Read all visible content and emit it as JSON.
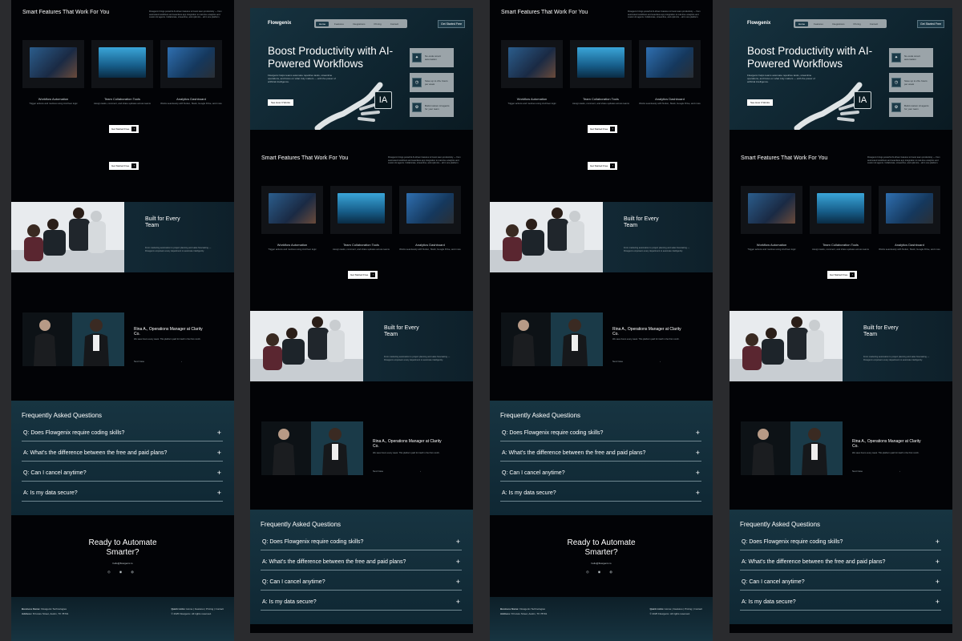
{
  "nav": {
    "brand": "Flowgenix",
    "links": [
      "Home",
      "Features",
      "Integrations",
      "Pricing",
      "Contact"
    ],
    "cta": "Get Started Free"
  },
  "hero": {
    "title": "Boost Productivity with AI-Powered Workflows",
    "desc": "Flowgenix helps teams automate repetitive tasks, streamline operations, and focus on what truly matters — with the power of artificial intelligence.",
    "button": "See How It Works",
    "badge": "IA",
    "cards": [
      "No-code smart automation",
      "Save up to 20+ hours per week",
      "Build custom AI agents for your team"
    ]
  },
  "features": {
    "title": "Smart Features That Work For You",
    "desc": "Flowgenix brings powerful AI-driven features to boost team productivity — from automated workflows and seamless app integration to real-time analytics and custom AI agents. Collaborate, streamline, and optimize – all in one platform.",
    "items": [
      {
        "name": "Workflow Automation",
        "sub": "Trigger actions and routines using AI-driven logic"
      },
      {
        "name": "Team Collaboration Tools",
        "sub": "Assign tasks, comment, and share updates across teams"
      },
      {
        "name": "Analytics Dashboard",
        "sub": "Works seamlessly with Notion, Slack, Google Drive, and more"
      }
    ],
    "button": "Get Started Free"
  },
  "team": {
    "title": "Built for Every Team",
    "desc": "From marketing automation to project planning and sales forecasting — Flowgenix empowers every department to automate intelligently."
  },
  "testimonial": {
    "name": "Rina A., Operations Manager at Clarity Co.",
    "quote": "We save hours every week. This platform paid for itself in the first month.",
    "next": "Next Case",
    "arrow": "›"
  },
  "faq": {
    "title": "Frequently Asked Questions",
    "items": [
      "Q: Does Flowgenix require coding skills?",
      "A: What's the difference between the free and paid plans?",
      "Q: Can I cancel anytime?",
      "A: Is my data secure?"
    ],
    "plus": "+"
  },
  "cta": {
    "title": "Ready to Automate Smarter?",
    "mail": "hello@flowgenix.io",
    "icons": "◎ ◉ ◍"
  },
  "footer": {
    "name_label": "Business Name:",
    "name": "Flowgenix Technologies",
    "addr_label": "Address:",
    "addr": "8 Future Street, Austin, TX 78701",
    "links_label": "Quick Links:",
    "links": "Home | Features | Pricing | Contact",
    "copy": "© 2025 Flowgenix. All rights reserved."
  },
  "colors": {
    "bg": "#020306",
    "teal": "#163240",
    "accent": "#1c3a48",
    "canvas": "#2a2b2e"
  }
}
